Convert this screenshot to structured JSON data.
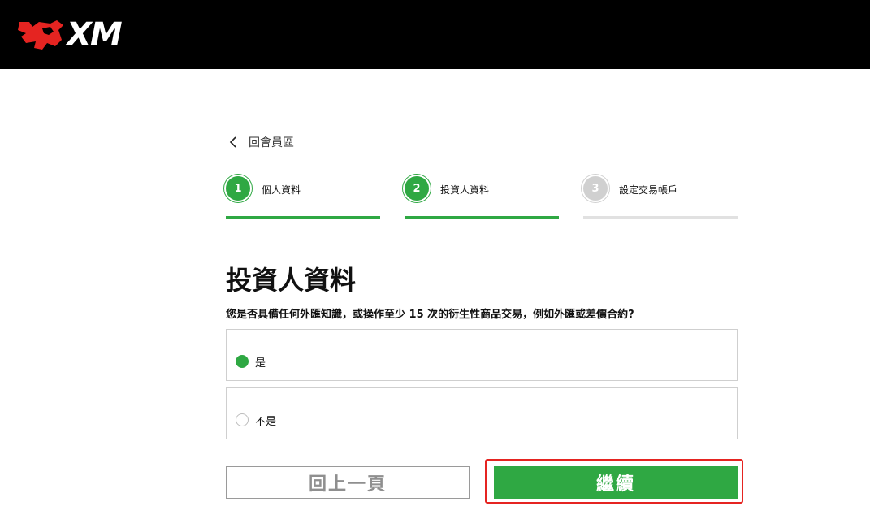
{
  "header": {
    "logo_text": "XM",
    "brand_color": "#000000",
    "logo_accent": "#e52421"
  },
  "back_link": {
    "label": "回會員區",
    "icon": "chevron-left-icon"
  },
  "steps": [
    {
      "number": "1",
      "label": "個人資料",
      "state": "complete"
    },
    {
      "number": "2",
      "label": "投資人資料",
      "state": "active"
    },
    {
      "number": "3",
      "label": "設定交易帳戶",
      "state": "pending"
    }
  ],
  "form": {
    "title": "投資人資料",
    "question": "您是否具備任何外匯知識，或操作至少 15 次的衍生性商品交易，例如外匯或差價合約?",
    "options": [
      {
        "label": "是",
        "selected": true
      },
      {
        "label": "不是",
        "selected": false
      }
    ]
  },
  "buttons": {
    "back_label": "回上一頁",
    "continue_label": "繼續"
  },
  "colors": {
    "accent_green": "#2fa843",
    "inactive_gray": "#d0d0d0",
    "highlight_red": "#e52421"
  }
}
